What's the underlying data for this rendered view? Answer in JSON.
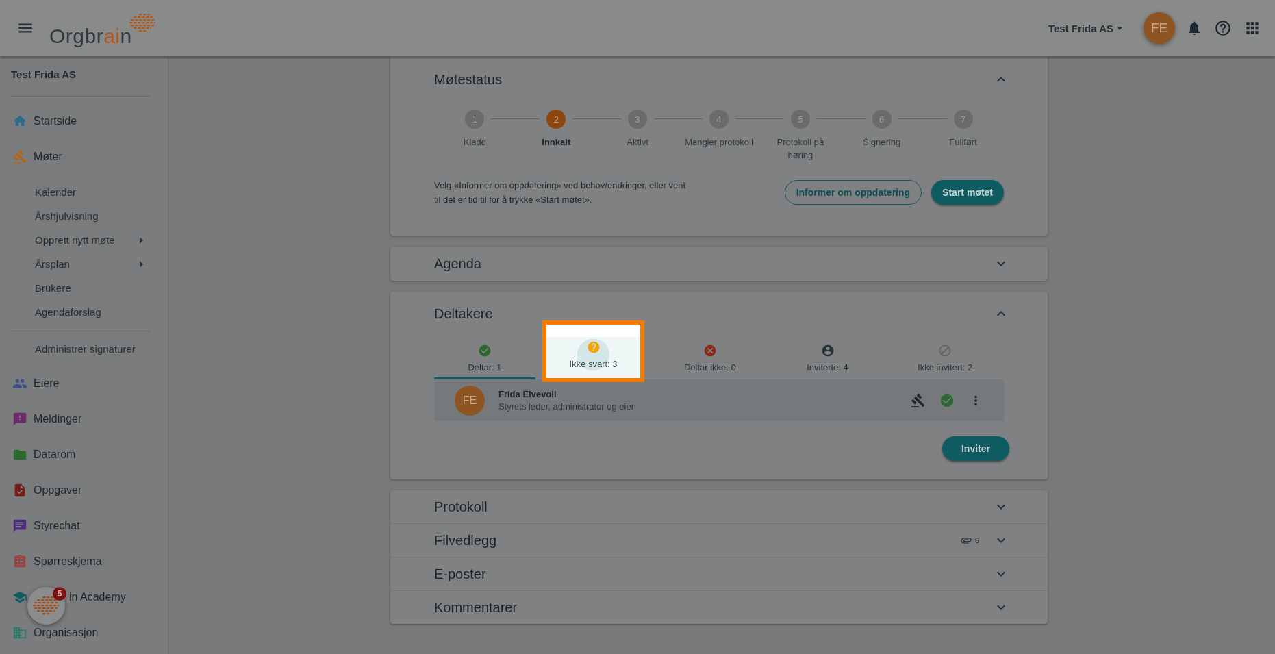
{
  "header": {
    "logo": [
      {
        "text": "Orgbr",
        "accent": false
      },
      {
        "text": "ai",
        "accent": true
      },
      {
        "text": "n",
        "accent": false
      }
    ],
    "company": "Test Frida AS",
    "avatar": "FE"
  },
  "sidebar": {
    "company": "Test Frida AS",
    "items": [
      {
        "label": "Startside",
        "color": "#2b6a8a"
      },
      {
        "label": "Møter",
        "color": "#b5631b",
        "children": [
          {
            "label": "Kalender",
            "submenu": false
          },
          {
            "label": "Årshjulvisning",
            "submenu": false
          },
          {
            "label": "Opprett nytt møte",
            "submenu": true
          },
          {
            "label": "Årsplan",
            "submenu": true
          },
          {
            "label": "Brukere",
            "submenu": false
          },
          {
            "label": "Agendaforslag",
            "submenu": false
          }
        ]
      },
      {
        "label": "Administrer signaturer",
        "kind": "plain"
      },
      {
        "label": "Eiere",
        "color": "#3d4f8a"
      },
      {
        "label": "Meldinger",
        "color": "#6b2a6b"
      },
      {
        "label": "Datarom",
        "color": "#2a6a2e"
      },
      {
        "label": "Oppgaver",
        "color": "#7a1c1c"
      },
      {
        "label": "Styrechat",
        "color": "#4e2d80"
      },
      {
        "label": "Spørreskjema",
        "color": "#9a4040"
      },
      {
        "label": "in Academy",
        "color": "#0f5c63",
        "partly_hidden": true
      },
      {
        "label": "Organisasjon",
        "color": "#2a7a6d"
      }
    ]
  },
  "chat_launcher": {
    "badge": "5"
  },
  "meeting_status": {
    "title": "Møtestatus",
    "expanded": true,
    "steps": [
      {
        "number": "1",
        "label": "Kladd",
        "selected": false
      },
      {
        "number": "2",
        "label": "Innkalt",
        "selected": true
      },
      {
        "number": "3",
        "label": "Aktivt",
        "selected": false
      },
      {
        "number": "4",
        "label": "Mangler protokoll",
        "selected": false
      },
      {
        "number": "5",
        "label": "Protokoll på høring",
        "selected": false
      },
      {
        "number": "6",
        "label": "Signering",
        "selected": false
      },
      {
        "number": "7",
        "label": "Fullført",
        "selected": false
      }
    ],
    "description": "Velg «Informer om oppdatering» ved behov/endringer, eller vent til det er tid til for å trykke «Start møtet».",
    "buttons": [
      {
        "label": "Informer om oppdatering",
        "kind": "outlined"
      },
      {
        "label": "Start møtet",
        "kind": "filled"
      }
    ]
  },
  "agenda": {
    "title": "Agenda",
    "expanded": false
  },
  "participants": {
    "title": "Deltakere",
    "expanded": true,
    "tabs": [
      {
        "label": "Deltar: 1",
        "selected": true,
        "highlighted": false
      },
      {
        "label": "Ikke svart: 3",
        "selected": false,
        "highlighted": true
      },
      {
        "label": "Deltar ikke: 0",
        "selected": false,
        "highlighted": false
      },
      {
        "label": "Inviterte: 4",
        "selected": false,
        "highlighted": false
      },
      {
        "label": "Ikke invitert: 2",
        "selected": false,
        "highlighted": false
      }
    ],
    "rows": [
      {
        "initials": "FE",
        "name": "Frida Elvevoll",
        "role": "Styrets leder, administrator og eier"
      }
    ],
    "button": "Inviter"
  },
  "panels": [
    {
      "title": "Protokoll",
      "expanded": false
    },
    {
      "title": "Filvedlegg",
      "expanded": false,
      "attachments": "6"
    },
    {
      "title": "E-poster",
      "expanded": false
    },
    {
      "title": "Kommentarer",
      "expanded": false
    }
  ]
}
